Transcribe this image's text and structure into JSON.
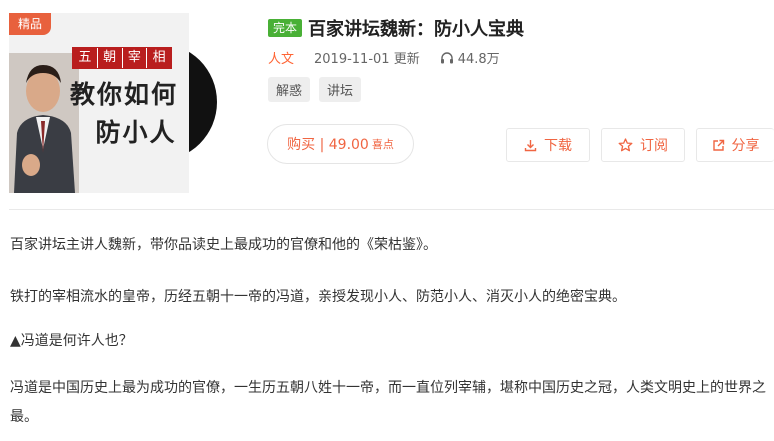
{
  "cover": {
    "badge": "精品",
    "series_chars": [
      "五",
      "朝",
      "宰",
      "相"
    ],
    "line1": "教你如何",
    "line2": "防小人"
  },
  "album": {
    "status_tag": "完本",
    "title": "百家讲坛魏新：防小人宝典",
    "category": "人文",
    "date": "2019-11-01 更新",
    "plays": "44.8万",
    "tags": [
      "解惑",
      "讲坛"
    ]
  },
  "actions": {
    "buy_label": "购买 | 49.00",
    "buy_unit": "喜点",
    "download": "下载",
    "subscribe": "订阅",
    "share": "分享"
  },
  "description": {
    "p1": "百家讲坛主讲人魏新，带你品读史上最成功的官僚和他的《荣枯鉴》。",
    "p2": "铁打的宰相流水的皇帝，历经五朝十一帝的冯道，亲授发现小人、防范小人、消灭小人的绝密宝典。",
    "p3": "▲冯道是何许人也？",
    "p4": "冯道是中国历史上最为成功的官僚，一生历五朝八姓十一帝，而一直位列宰辅，堪称中国历史之冠，人类文明史上的世界之最。"
  },
  "colors": {
    "accent": "#f06542",
    "finished_tag": "#49b036",
    "badge": "#e8613d",
    "seal_red": "#b91e1e"
  },
  "icons": {
    "plays": "headphones-icon",
    "download": "download-icon",
    "subscribe": "star-icon",
    "share": "share-icon"
  }
}
